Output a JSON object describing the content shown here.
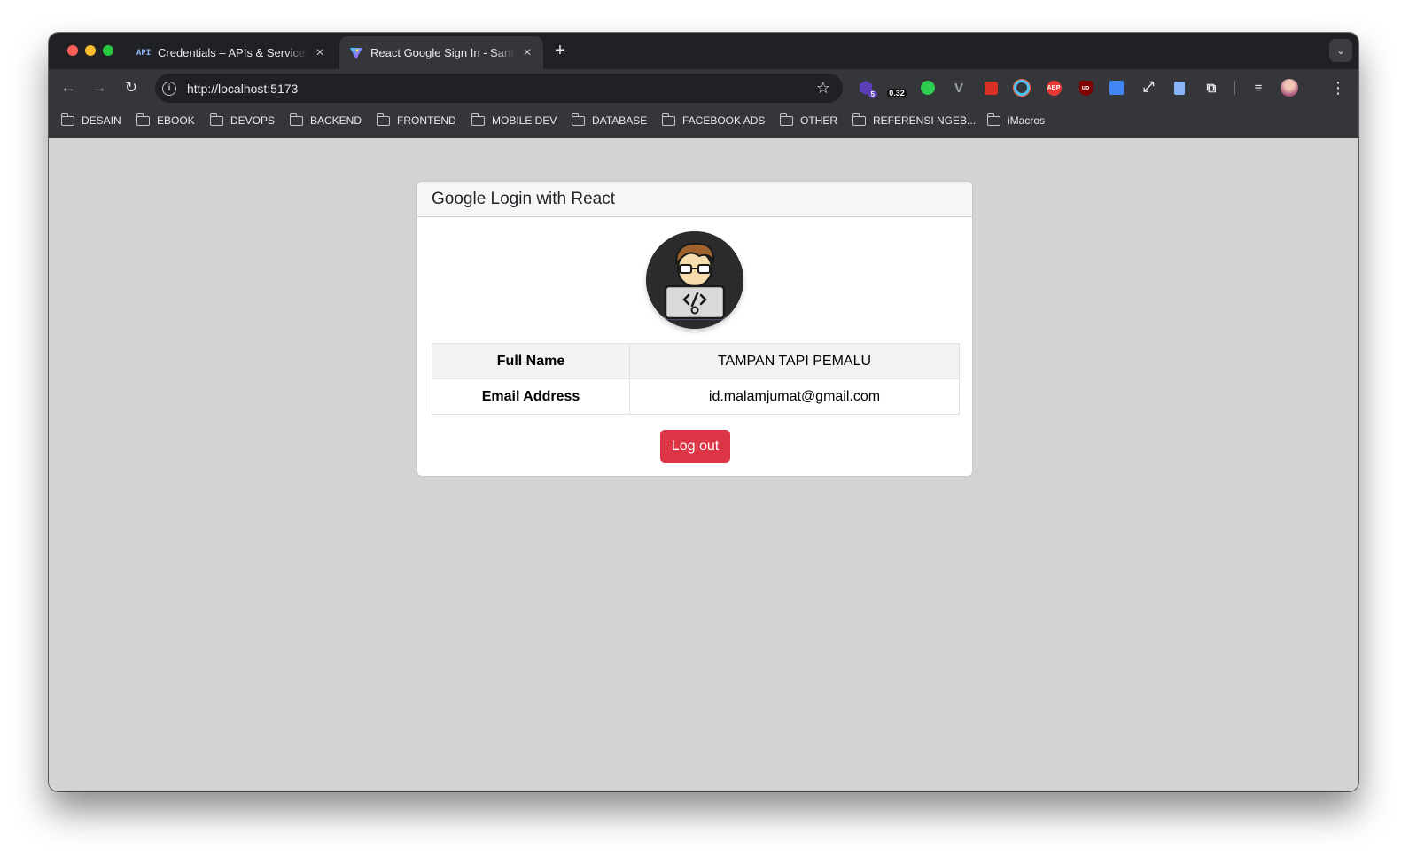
{
  "browser": {
    "tabs": [
      {
        "favicon": "API",
        "title": "Credentials – APIs & Services",
        "close": "×"
      },
      {
        "favicon": "vite-logo",
        "title": "React Google Sign In - Santri",
        "close": "×"
      }
    ],
    "new_tab": "+",
    "tab_search": "⌄",
    "url": "http://localhost:5173",
    "extensions": [
      {
        "name": "purple-cube-extension",
        "badge": "5"
      },
      {
        "name": "speed-extension",
        "badge": "0.32"
      },
      {
        "name": "green-dot-extension"
      },
      {
        "name": "vue-devtools-extension"
      },
      {
        "name": "red-camera-extension"
      },
      {
        "name": "color-ring-extension"
      },
      {
        "name": "adblock-plus-extension",
        "badge": "ABP"
      },
      {
        "name": "ublock-origin-extension",
        "badge": "uo"
      },
      {
        "name": "google-translate-extension"
      },
      {
        "name": "expand-arrows-extension"
      },
      {
        "name": "document-extension"
      },
      {
        "name": "extensions-puzzle"
      }
    ],
    "bookmarks": [
      "DESAIN",
      "EBOOK",
      "DEVOPS",
      "BACKEND",
      "FRONTEND",
      "MOBILE DEV",
      "DATABASE",
      "FACEBOOK ADS",
      "OTHER",
      "REFERENSI NGEB...",
      "iMacros"
    ]
  },
  "page": {
    "card_title": "Google Login with React",
    "avatar_icon": "developer-avatar-icon",
    "rows": [
      {
        "label": "Full Name",
        "value": "TAMPAN TAPI PEMALU"
      },
      {
        "label": "Email Address",
        "value": "id.malamjumat@gmail.com"
      }
    ],
    "logout_label": "Log out"
  },
  "colors": {
    "page_background": "#d3d3d3",
    "logout_button": "#dc3545",
    "chrome_dark": "#35363a"
  }
}
